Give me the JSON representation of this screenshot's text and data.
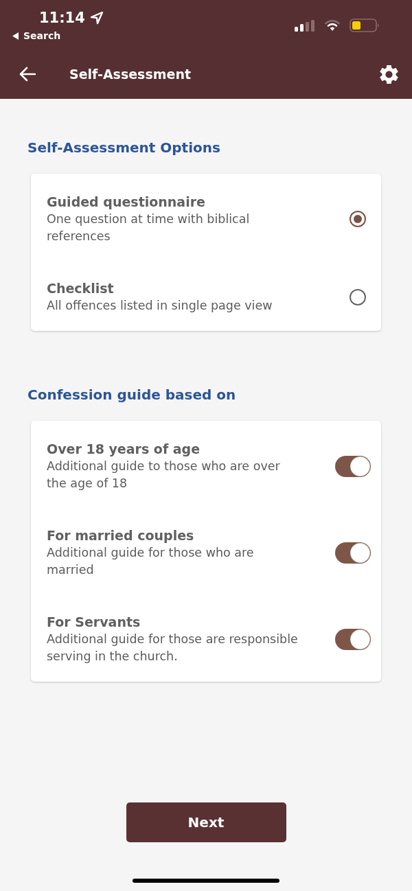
{
  "status_bar": {
    "time": "11:14",
    "back_app_label": "Search"
  },
  "app_bar": {
    "title": "Self-Assessment"
  },
  "sections": [
    {
      "heading": "Self-Assessment Options",
      "options": [
        {
          "kind": "radio",
          "title": "Guided questionnaire",
          "description": "One question at time with biblical references",
          "selected": true
        },
        {
          "kind": "radio",
          "title": "Checklist",
          "description": "All offences listed in single page view",
          "selected": false
        }
      ]
    },
    {
      "heading": "Confession guide based on",
      "options": [
        {
          "kind": "toggle",
          "title": "Over 18 years of age",
          "description": "Additional guide to those who are over the age of 18",
          "on": true
        },
        {
          "kind": "toggle",
          "title": "For married couples",
          "description": "Additional guide for those who are married",
          "on": true
        },
        {
          "kind": "toggle",
          "title": "For Servants",
          "description": "Additional guide for those are responsible serving in the church.",
          "on": true
        }
      ]
    }
  ],
  "next_button": {
    "label": "Next"
  }
}
